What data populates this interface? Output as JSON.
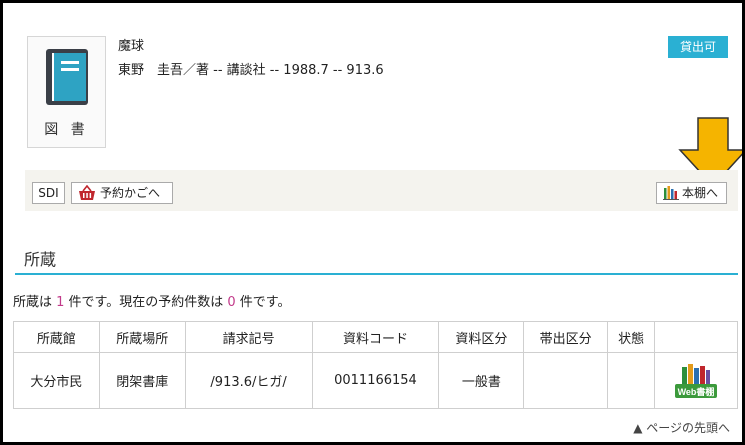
{
  "item": {
    "type_label": "図 書",
    "title": "魔球",
    "meta": "東野　圭吾／著 -- 講談社 -- 1988.7 -- 913.6",
    "status_badge": "貸出可",
    "icon": "book-icon"
  },
  "toolbar": {
    "sdi_label": "SDI",
    "basket_label": "予約かごへ",
    "shelf_label": "本棚へ",
    "basket_icon": "basket-icon",
    "shelf_icon": "bookshelf-icon"
  },
  "annotation": {
    "arrow_color": "#f5b400",
    "arrow_direction": "down"
  },
  "holdings": {
    "section_title": "所蔵",
    "summary_prefix": "所蔵は ",
    "holdings_count": "1",
    "summary_middle": " 件です。現在の予約件数は ",
    "reservation_count": "0",
    "summary_suffix": " 件です。",
    "columns": [
      "所蔵館",
      "所蔵場所",
      "請求記号",
      "資料コード",
      "資料区分",
      "帯出区分",
      "状態",
      ""
    ],
    "rows": [
      {
        "library": "大分市民",
        "location": "閉架書庫",
        "call_number": "/913.6/ヒガ/",
        "item_code": "0011166154",
        "material_type": "一般書",
        "loan_type": "",
        "status": "",
        "web_shelf_label": "Web書棚"
      }
    ]
  },
  "footer": {
    "page_top": "▲ ページの先頭へ"
  },
  "colors": {
    "accent": "#2ab0d3",
    "count_highlight": "#c23a8a",
    "toolbar_bg": "#f4f3ee"
  }
}
